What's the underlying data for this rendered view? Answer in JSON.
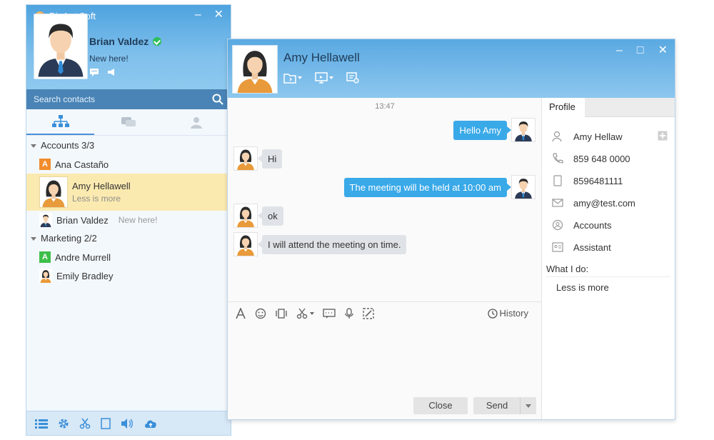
{
  "app": {
    "title": "BigAnt Soft",
    "user_name": "Brian Valdez",
    "user_status": "New here!"
  },
  "search": {
    "placeholder": "Search contacts"
  },
  "nav_tabs": [
    "org-tree-icon",
    "chat-bubbles-icon",
    "person-icon"
  ],
  "groups": [
    {
      "label": "Accounts 3/3",
      "contacts": [
        {
          "name": "Ana Castaño",
          "letter": "A",
          "color": "#f28c2c"
        },
        {
          "name": "Amy Hellawell",
          "status": "Less is more",
          "selected": true
        },
        {
          "name": "Brian Valdez",
          "status": "New here!"
        }
      ]
    },
    {
      "label": "Marketing 2/2",
      "contacts": [
        {
          "name": "Andre Murrell",
          "letter": "A",
          "color": "#3fbf4a"
        },
        {
          "name": "Emily Bradley"
        }
      ]
    }
  ],
  "chat": {
    "title": "Amy Hellawell",
    "timestamp": "13:47",
    "messages": [
      {
        "dir": "out",
        "text": "Hello Amy"
      },
      {
        "dir": "in",
        "text": "Hi"
      },
      {
        "dir": "out",
        "text": "The meeting will be held at 10:00 am"
      },
      {
        "dir": "in",
        "text": "ok"
      },
      {
        "dir": "in",
        "text": "I will attend the meeting on time."
      }
    ],
    "history_label": "History",
    "close_label": "Close",
    "send_label": "Send"
  },
  "profile": {
    "tab_label": "Profile",
    "name": "Amy Hellaw",
    "phone": "859 648 0000",
    "mobile": "8596481111",
    "email": "amy@test.com",
    "department": "Accounts",
    "position": "Assistant",
    "what_i_do_label": "What I do:",
    "what_i_do": "Less is more"
  },
  "colors": {
    "header_blue": "#4ea3df",
    "bubble_out": "#39a9e8",
    "bubble_in": "#dfe3e7",
    "selected_row": "#fbeab0",
    "online": "#2dbd5a"
  }
}
